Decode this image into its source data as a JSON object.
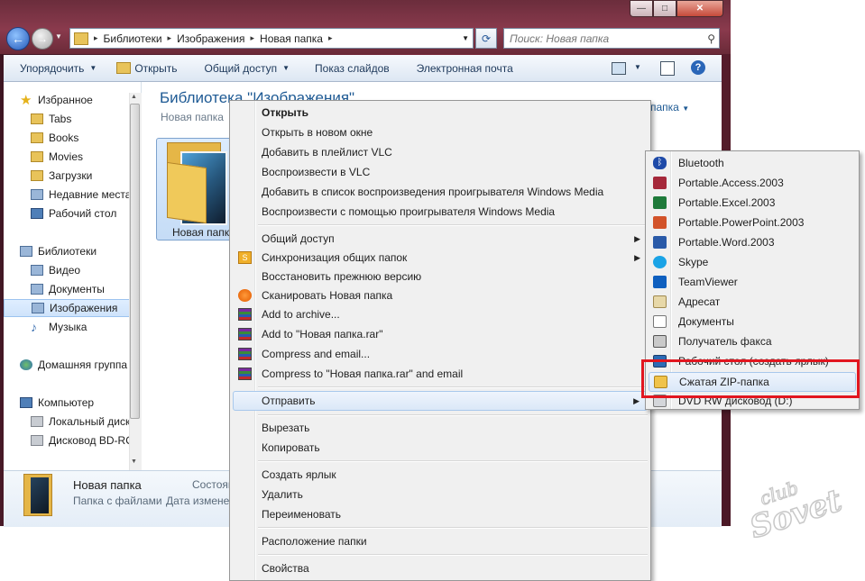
{
  "window": {
    "caption_minimize": "—",
    "caption_maximize": "□",
    "caption_close": "✕"
  },
  "address": {
    "segments": [
      "Библиотеки",
      "Изображения",
      "Новая папка"
    ],
    "separator": "▸",
    "dropdown": "▼"
  },
  "search": {
    "placeholder": "Поиск: Новая папка"
  },
  "toolbar": {
    "organize": "Упорядочить",
    "open": "Открыть",
    "share": "Общий доступ",
    "slideshow": "Показ слайдов",
    "email": "Электронная почта"
  },
  "icons": [
    "back-arrow-icon",
    "forward-arrow-icon",
    "refresh-icon",
    "search-icon",
    "view-icon",
    "preview-pane-icon",
    "help-icon"
  ],
  "sidebar": {
    "favorites": "Избранное",
    "items": [
      {
        "label": "Tabs",
        "icon": "folder-icon"
      },
      {
        "label": "Books",
        "icon": "folder-icon"
      },
      {
        "label": "Movies",
        "icon": "folder-icon"
      },
      {
        "label": "Загрузки",
        "icon": "downloads-icon"
      },
      {
        "label": "Недавние места",
        "icon": "recent-places-icon"
      },
      {
        "label": "Рабочий стол",
        "icon": "desktop-icon"
      }
    ],
    "libraries": "Библиотеки",
    "library_items": [
      {
        "label": "Видео",
        "icon": "video-library-icon"
      },
      {
        "label": "Документы",
        "icon": "documents-library-icon"
      },
      {
        "label": "Изображения",
        "icon": "pictures-library-icon",
        "selected": true
      },
      {
        "label": "Музыка",
        "icon": "music-library-icon"
      }
    ],
    "homegroup": "Домашняя группа",
    "computer": "Компьютер",
    "computer_items": [
      {
        "label": "Локальный диск",
        "icon": "local-disk-icon"
      },
      {
        "label": "Дисковод BD-ROM",
        "icon": "bd-rom-drive-icon"
      }
    ]
  },
  "content": {
    "library_title": "Библиотека \"Изображения\"",
    "library_subtitle": "Новая папка",
    "arrange_label": "папка",
    "arrange_arrow": "▼",
    "folder_name": "Новая папка"
  },
  "details": {
    "name": "Новая папка",
    "type": "Папка с файлами",
    "state_label": "Состояние",
    "date_label": "Дата изменения"
  },
  "context_menu": {
    "items": [
      {
        "label": "Открыть",
        "bold": true
      },
      {
        "label": "Открыть в новом окне"
      },
      {
        "label": "Добавить в плейлист VLC",
        "icon": "vlc-icon"
      },
      {
        "label": "Воспроизвести в VLC",
        "icon": "vlc-icon"
      },
      {
        "label": "Добавить в список воспроизведения проигрывателя Windows Media"
      },
      {
        "label": "Воспроизвести с помощью проигрывателя Windows Media"
      },
      {
        "label": "Общий доступ",
        "submenu": true
      },
      {
        "label": "Синхронизация общих папок",
        "submenu": true,
        "icon": "sync-icon"
      },
      {
        "label": "Восстановить прежнюю версию"
      },
      {
        "label": "Сканировать Новая папка",
        "icon": "avast-icon"
      },
      {
        "label": "Add to archive...",
        "icon": "winrar-icon"
      },
      {
        "label": "Add to \"Новая папка.rar\"",
        "icon": "winrar-icon"
      },
      {
        "label": "Compress and email...",
        "icon": "winrar-icon"
      },
      {
        "label": "Compress to \"Новая папка.rar\" and email",
        "icon": "winrar-icon"
      },
      {
        "label": "Отправить",
        "submenu": true,
        "highlighted": true
      },
      {
        "label": "Вырезать"
      },
      {
        "label": "Копировать"
      },
      {
        "label": "Создать ярлык"
      },
      {
        "label": "Удалить"
      },
      {
        "label": "Переименовать"
      },
      {
        "label": "Расположение папки"
      },
      {
        "label": "Свойства"
      }
    ],
    "submenu_arrow": "▶"
  },
  "send_to_menu": {
    "items": [
      {
        "label": "Bluetooth",
        "icon": "bluetooth-icon"
      },
      {
        "label": "Portable.Access.2003",
        "icon": "access-icon"
      },
      {
        "label": "Portable.Excel.2003",
        "icon": "excel-icon"
      },
      {
        "label": "Portable.PowerPoint.2003",
        "icon": "powerpoint-icon"
      },
      {
        "label": "Portable.Word.2003",
        "icon": "word-icon"
      },
      {
        "label": "Skype",
        "icon": "skype-icon"
      },
      {
        "label": "TeamViewer",
        "icon": "teamviewer-icon"
      },
      {
        "label": "Адресат",
        "icon": "mail-recipient-icon"
      },
      {
        "label": "Документы",
        "icon": "documents-icon"
      },
      {
        "label": "Получатель факса",
        "icon": "fax-icon"
      },
      {
        "label": "Рабочий стол (создать ярлык)",
        "icon": "desktop-shortcut-icon"
      },
      {
        "label": "Сжатая ZIP-папка",
        "icon": "zip-folder-icon",
        "highlighted": true
      },
      {
        "label": "DVD RW дисковод (D:)",
        "icon": "dvd-drive-icon"
      }
    ]
  },
  "watermark": {
    "line1": "club",
    "line2": "Sovet"
  },
  "colors": {
    "highlight_box": "#e2161f",
    "title_blue": "#1e5a94",
    "window_frame": "#7a2a3a"
  }
}
